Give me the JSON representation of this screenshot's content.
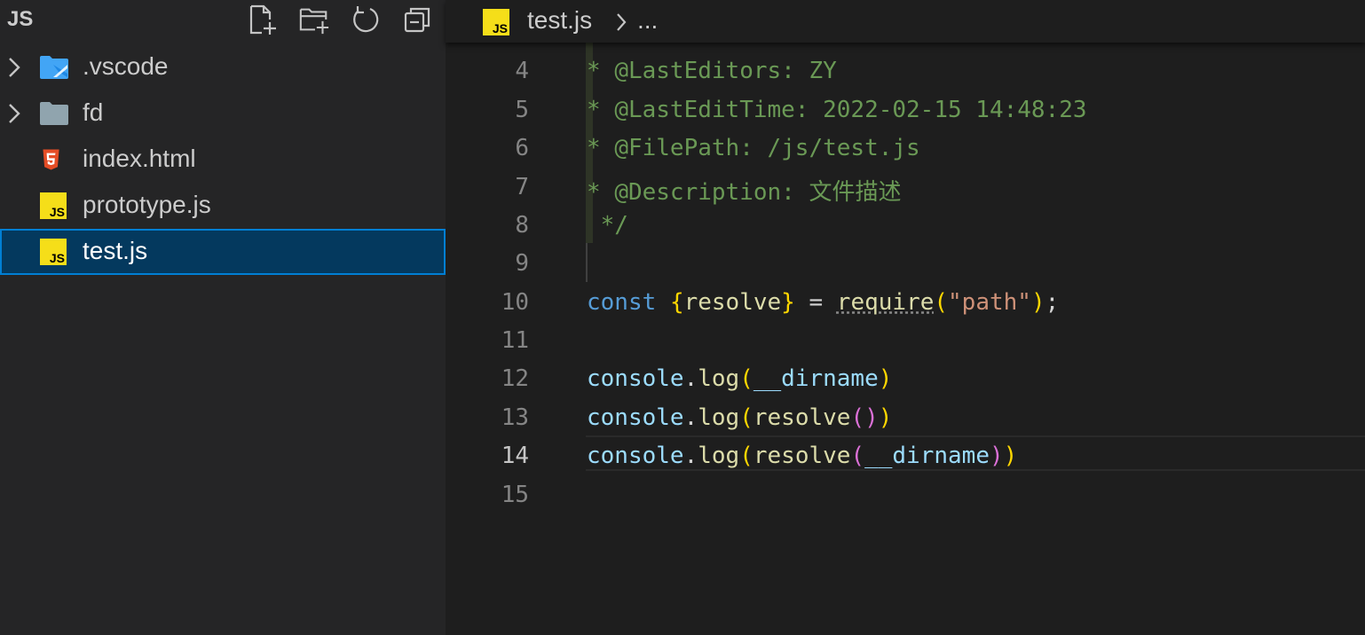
{
  "explorer": {
    "title": "JS",
    "actions": [
      {
        "name": "new-file-icon"
      },
      {
        "name": "new-folder-icon"
      },
      {
        "name": "refresh-icon"
      },
      {
        "name": "collapse-all-icon"
      }
    ],
    "items": [
      {
        "label": ".vscode",
        "type": "folder",
        "icon": "vscode-folder-icon"
      },
      {
        "label": "fd",
        "type": "folder",
        "icon": "folder-icon"
      },
      {
        "label": "index.html",
        "type": "file",
        "icon": "html5-icon"
      },
      {
        "label": "prototype.js",
        "type": "file",
        "icon": "js-icon"
      },
      {
        "label": "test.js",
        "type": "file",
        "icon": "js-icon",
        "selected": true
      }
    ]
  },
  "breadcrumb": {
    "file": "test.js",
    "more": "..."
  },
  "editor": {
    "active_line": "14",
    "lines": [
      {
        "n": "4",
        "text": " * @LastEditors: ZY"
      },
      {
        "n": "5",
        "text": " * @LastEditTime: 2022-02-15 14:48:23"
      },
      {
        "n": "6",
        "text": " * @FilePath: /js/test.js"
      },
      {
        "n": "7",
        "text": " * @Description: 文件描述"
      },
      {
        "n": "8",
        "text": " */"
      },
      {
        "n": "9",
        "text": ""
      },
      {
        "n": "10",
        "text": "const {resolve} = require(\"path\");"
      },
      {
        "n": "11",
        "text": ""
      },
      {
        "n": "12",
        "text": "console.log(__dirname)"
      },
      {
        "n": "13",
        "text": "console.log(resolve())"
      },
      {
        "n": "14",
        "text": "console.log(resolve(__dirname))"
      },
      {
        "n": "15",
        "text": ""
      }
    ],
    "tokens": {
      "star": "*",
      "c4": "@LastEditors: ZY",
      "c5": "@LastEditTime: 2022-02-15 14:48:23",
      "c6": "@FilePath: /js/test.js",
      "c7": "@Description: 文件描述",
      "c8": "*/",
      "const": "const",
      "open_brace": "{",
      "resolve": "resolve",
      "close_brace": "}",
      "eq": " = ",
      "require": "require",
      "open_paren": "(",
      "path_str": "\"path\"",
      "close_paren": ")",
      "semi": ";",
      "console": "console",
      "dot": ".",
      "log": "log",
      "dirname": "__dirname"
    }
  },
  "colors": {
    "sidebar_bg": "#252526",
    "editor_bg": "#1e1e1e",
    "selection_bg": "#04395e",
    "selection_border": "#007fd4",
    "comment": "#6a9955",
    "keyword": "#569cd6",
    "variable": "#9cdcfe",
    "function": "#dcdcaa",
    "string": "#ce9178",
    "bracket1": "#ffd700",
    "bracket2": "#da70d6"
  }
}
